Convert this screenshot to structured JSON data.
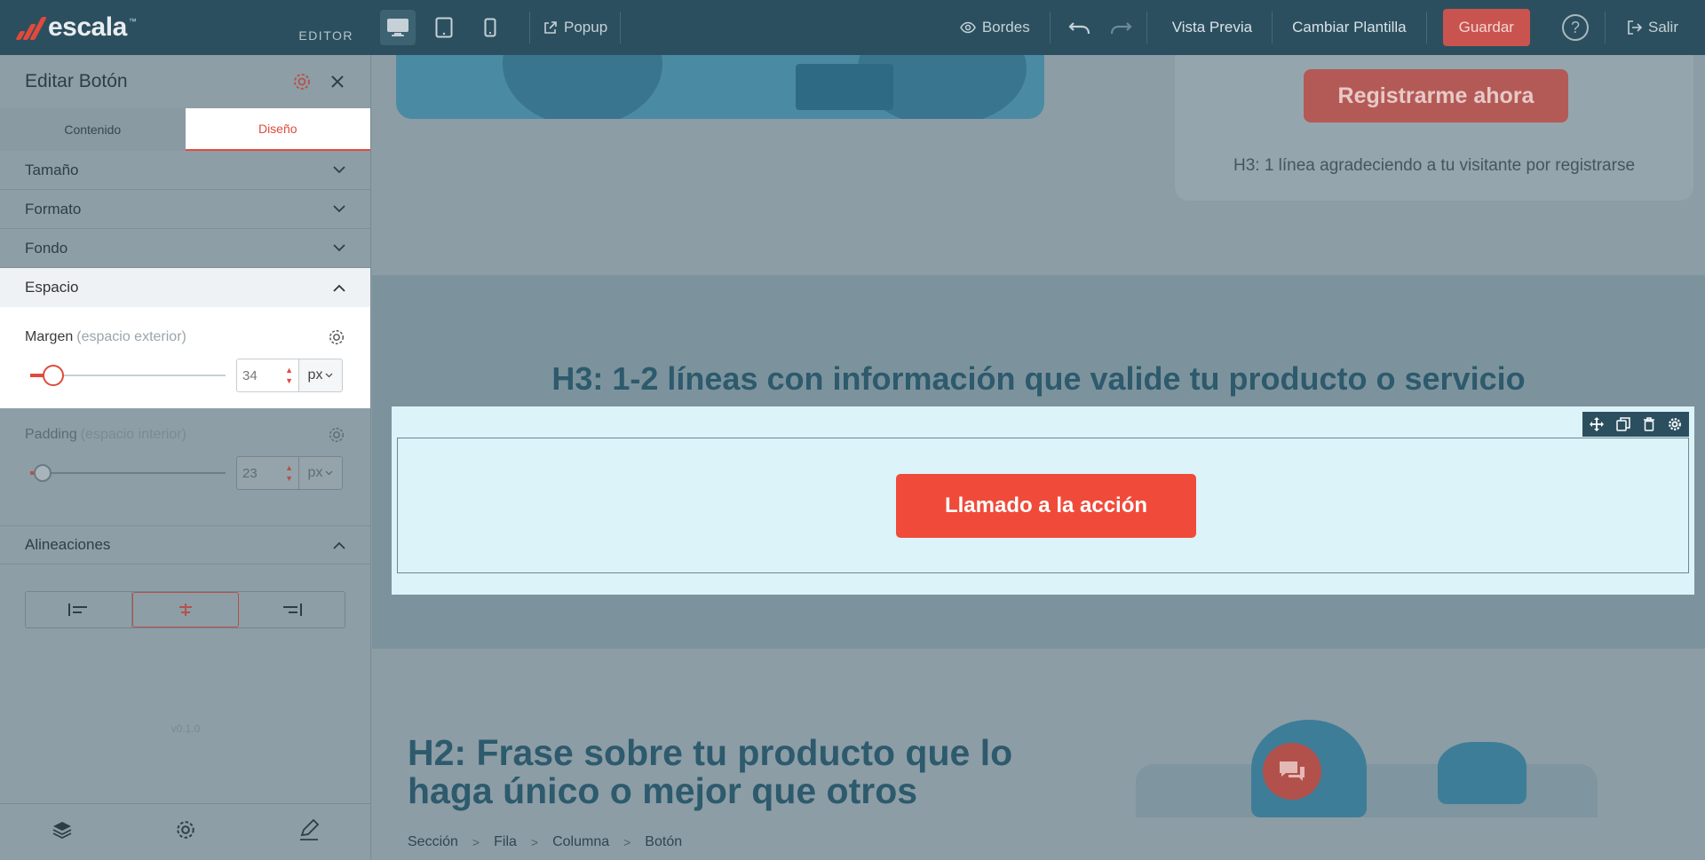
{
  "brand": {
    "name": "escala",
    "tm": "™",
    "editor_label": "EDITOR"
  },
  "toolbar": {
    "popup_label": "Popup",
    "borders_label": "Bordes",
    "preview_label": "Vista Previa",
    "change_template_label": "Cambiar Plantilla",
    "save_label": "Guardar",
    "help_label": "?",
    "exit_label": "Salir",
    "active_device": "desktop"
  },
  "sidebar": {
    "title": "Editar Botón",
    "tabs": [
      {
        "label": "Contenido",
        "active": false
      },
      {
        "label": "Diseño",
        "active": true
      }
    ],
    "sections": {
      "size": "Tamaño",
      "format": "Formato",
      "background": "Fondo",
      "space": "Espacio",
      "alignments": "Alineaciones"
    },
    "margin": {
      "label": "Margen",
      "hint": "(espacio exterior)",
      "value": "34",
      "unit": "px",
      "level": 0.1
    },
    "padding": {
      "label": "Padding",
      "hint": "(espacio interior)",
      "value": "23",
      "unit": "px",
      "level": 0.05
    },
    "alignment_active": "center",
    "version": "v0.1.0"
  },
  "canvas": {
    "register_button": "Registrarme ahora",
    "register_text": "H3: 1 línea agradeciendo a tu visitante por registrarse",
    "validation_heading": "H3: 1-2 líneas con información que valide tu producto o servicio",
    "cta_button": "Llamado a la acción",
    "unique_heading": "H2: Frase sobre tu producto que lo haga único o mejor que otros"
  },
  "breadcrumb": [
    "Sección",
    "Fila",
    "Columna",
    "Botón"
  ],
  "colors": {
    "accent": "#e04a3b",
    "topbar": "#2b4f5f",
    "cta": "#f04b3a",
    "selected_row_bg": "#dcf3f9",
    "heading": "#2d5a6c"
  }
}
